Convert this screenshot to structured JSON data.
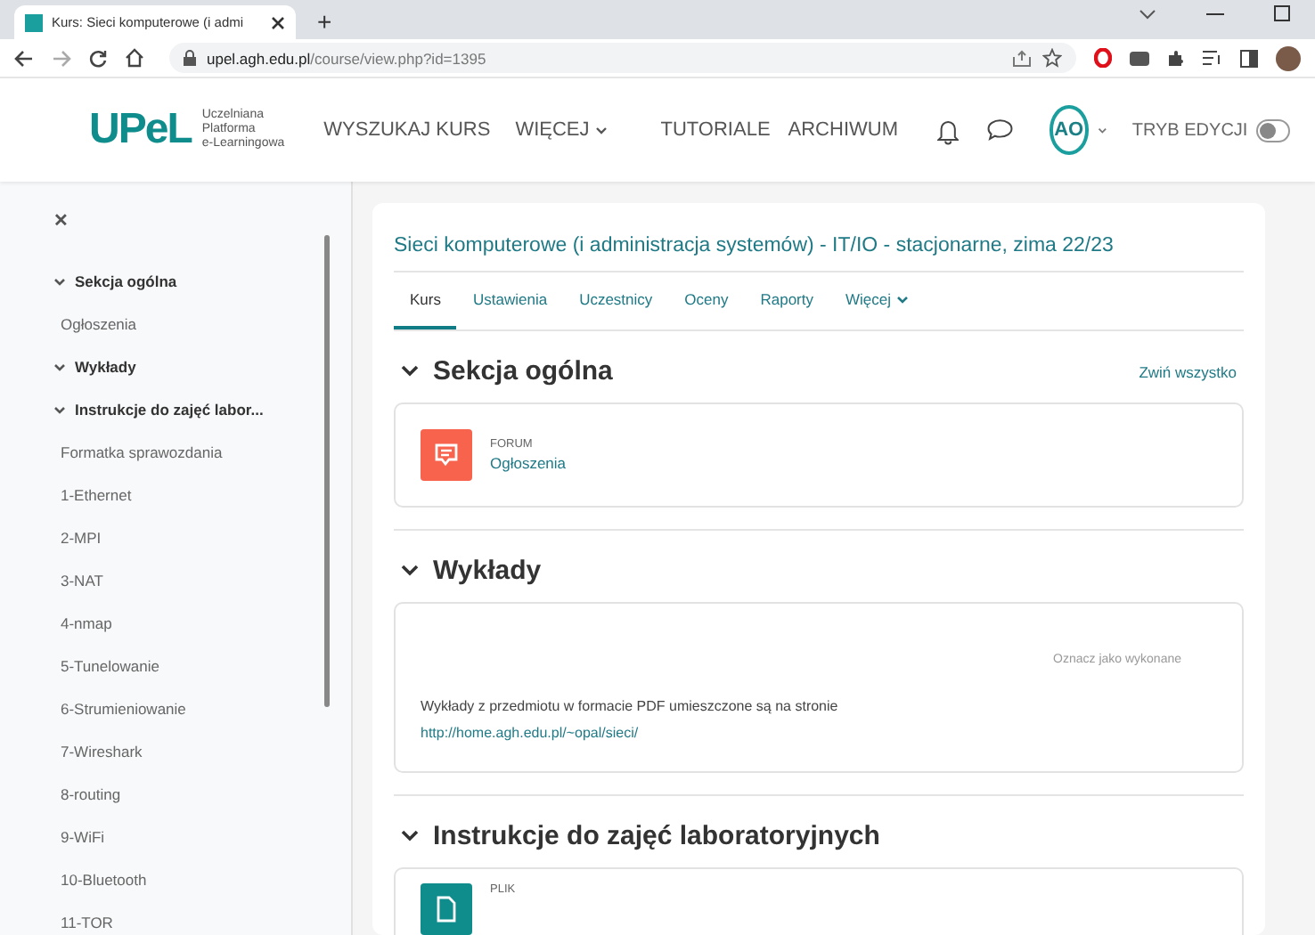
{
  "browser": {
    "tab_title": "Kurs: Sieci komputerowe (i admi",
    "new_tab": "+",
    "url_host": "upel.agh.edu.pl",
    "url_path": "/course/view.php?id=1395"
  },
  "header": {
    "logo": "UPeL",
    "logo_caption": [
      "Uczelniana",
      "Platforma",
      "e-Learningowa"
    ],
    "nav": [
      {
        "label": "WYSZUKAJ KURS",
        "dropdown": false
      },
      {
        "label": "WIĘCEJ",
        "dropdown": true
      },
      {
        "label": "TUTORIALE",
        "dropdown": false
      },
      {
        "label": "ARCHIWUM",
        "dropdown": false
      }
    ],
    "avatar": "AO",
    "edit_mode": {
      "label": "TRYB EDYCJI",
      "on": false
    }
  },
  "sidebar": {
    "close": "✕",
    "items": [
      {
        "kind": "section",
        "label": "Sekcja ogólna"
      },
      {
        "kind": "activity",
        "label": "Ogłoszenia"
      },
      {
        "kind": "section",
        "label": "Wykłady"
      },
      {
        "kind": "section",
        "label": "Instrukcje do zajęć labor..."
      },
      {
        "kind": "activity",
        "label": "Formatka sprawozdania"
      },
      {
        "kind": "activity",
        "label": "1-Ethernet"
      },
      {
        "kind": "activity",
        "label": "2-MPI"
      },
      {
        "kind": "activity",
        "label": "3-NAT"
      },
      {
        "kind": "activity",
        "label": "4-nmap"
      },
      {
        "kind": "activity",
        "label": "5-Tunelowanie"
      },
      {
        "kind": "activity",
        "label": "6-Strumieniowanie"
      },
      {
        "kind": "activity",
        "label": "7-Wireshark"
      },
      {
        "kind": "activity",
        "label": "8-routing"
      },
      {
        "kind": "activity",
        "label": "9-WiFi"
      },
      {
        "kind": "activity",
        "label": "10-Bluetooth"
      },
      {
        "kind": "activity",
        "label": "11-TOR"
      }
    ]
  },
  "course": {
    "title": "Sieci komputerowe (i administracja systemów) - IT/IO - stacjonarne, zima 22/23",
    "tabs": [
      {
        "label": "Kurs",
        "selected": true,
        "dropdown": false
      },
      {
        "label": "Ustawienia",
        "selected": false,
        "dropdown": false
      },
      {
        "label": "Uczestnicy",
        "selected": false,
        "dropdown": false
      },
      {
        "label": "Oceny",
        "selected": false,
        "dropdown": false
      },
      {
        "label": "Raporty",
        "selected": false,
        "dropdown": false
      },
      {
        "label": "Więcej",
        "selected": false,
        "dropdown": true
      }
    ],
    "collapse_all": "Zwiń wszystko",
    "sections": [
      {
        "title": "Sekcja ogólna",
        "items": [
          {
            "kind": "forum",
            "type_label": "FORUM",
            "name": "Ogłoszenia"
          }
        ]
      },
      {
        "title": "Wykłady",
        "items": [
          {
            "kind": "label",
            "mark_done": "Oznacz jako wykonane",
            "text": "Wykłady z przedmiotu w formacie PDF umieszczone są na stronie",
            "link": "http://home.agh.edu.pl/~opal/sieci/"
          }
        ]
      },
      {
        "title": "Instrukcje do zajęć laboratoryjnych",
        "items": [
          {
            "kind": "file",
            "type_label": "PLIK"
          }
        ]
      }
    ]
  }
}
